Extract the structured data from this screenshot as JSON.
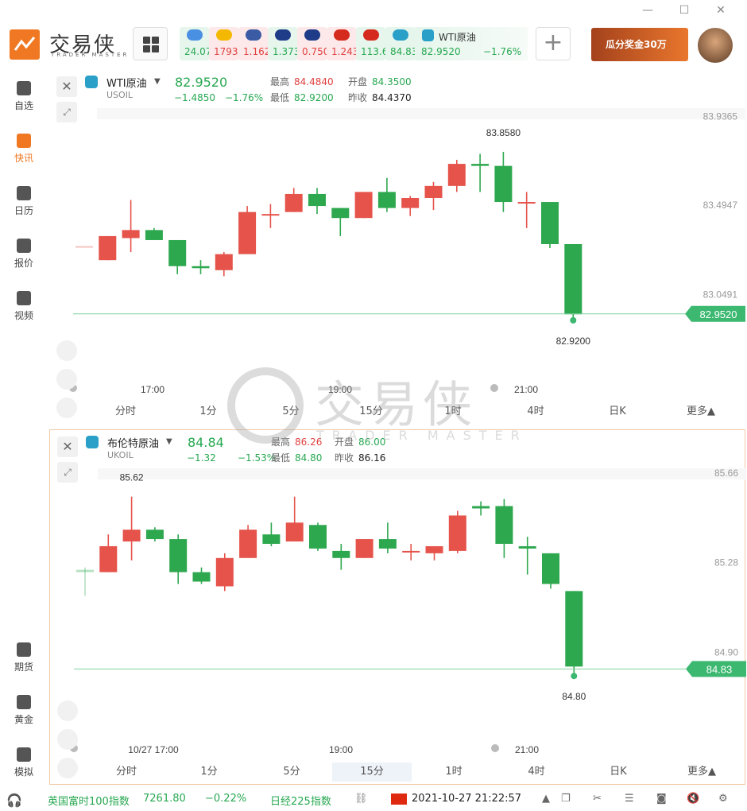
{
  "window": {
    "minimize": "—",
    "maximize": "☐",
    "close": "✕"
  },
  "app": {
    "logo_text": "交易侠",
    "logo_sub": "TRADER MASTER"
  },
  "tickers": [
    {
      "icon": "speech-bubble-icon",
      "value": "24.07",
      "dir": "dn",
      "color": "#4a90e2"
    },
    {
      "icon": "gold-bars-icon",
      "value": "1793",
      "dir": "up",
      "color": "#f5b800"
    },
    {
      "icon": "us-flag-icon",
      "value": "1.162",
      "dir": "up",
      "color": "#3b5ba5"
    },
    {
      "icon": "uk-flag-icon",
      "value": "1.373",
      "dir": "dn",
      "color": "#1f3c88"
    },
    {
      "icon": "au-flag-icon",
      "value": "0.750",
      "dir": "up",
      "color": "#1f3c88"
    },
    {
      "icon": "ca-flag-icon",
      "value": "1.243",
      "dir": "up",
      "color": "#d52b1e"
    },
    {
      "icon": "jp-flag-icon",
      "value": "113.6",
      "dir": "dn",
      "color": "#d52b1e"
    },
    {
      "icon": "ukoil-icon",
      "value": "84.83",
      "dir": "dn",
      "color": "#2aa0c8"
    }
  ],
  "ticker_active": {
    "name": "WTI原油",
    "price": "82.9520",
    "change": "−1.76%"
  },
  "promo": {
    "text": "瓜分奖金30万"
  },
  "sidebar": {
    "items": [
      {
        "label": "自选",
        "icon": "bookmark-icon"
      },
      {
        "label": "快讯",
        "icon": "news-list-icon",
        "active": true
      },
      {
        "label": "日历",
        "icon": "calendar-icon"
      },
      {
        "label": "报价",
        "icon": "trend-chart-icon"
      },
      {
        "label": "视频",
        "icon": "video-play-icon"
      }
    ],
    "bottom_items": [
      {
        "label": "期货",
        "icon": "futures-icon"
      },
      {
        "label": "黄金",
        "icon": "sge-gold-icon"
      },
      {
        "label": "模拟",
        "icon": "wallet-icon"
      }
    ]
  },
  "timeframes": [
    "分时",
    "1分",
    "5分",
    "15分",
    "1时",
    "4时",
    "日K",
    "更多▲"
  ],
  "panels": [
    {
      "name": "WTI原油",
      "symbol": "USOIL",
      "price": "82.9520",
      "change": "−1.4850",
      "change_pct": "−1.76%",
      "high_label": "最高",
      "high": "84.4840",
      "open_label": "开盘",
      "open": "84.3500",
      "low_label": "最低",
      "low": "82.9200",
      "prev_label": "昨收",
      "prev": "84.4370",
      "active_tf": "15分",
      "last_tag": "82.9520",
      "max_label": "83.8580",
      "min_label": "82.9200"
    },
    {
      "name": "布伦特原油",
      "symbol": "UKOIL",
      "price": "84.84",
      "change": "−1.32",
      "change_pct": "−1.53%",
      "high_label": "最高",
      "high": "86.26",
      "open_label": "开盘",
      "open": "86.00",
      "low_label": "最低",
      "low": "84.80",
      "prev_label": "昨收",
      "prev": "86.16",
      "active_tf": "15分",
      "last_tag": "84.83",
      "max_label": "85.62",
      "min_label": "84.80"
    }
  ],
  "chart_data": [
    {
      "type": "candlestick",
      "title": "WTI原油",
      "yticks": [
        "83.9365",
        "83.4947",
        "83.0491"
      ],
      "ytick_values": [
        83.9365,
        83.4947,
        83.0491
      ],
      "xticks": [
        "17:00",
        "19:00",
        "21:00"
      ],
      "last": 82.952,
      "ylim": [
        82.86,
        83.97
      ],
      "candles": [
        {
          "o": 83.29,
          "h": 83.29,
          "l": 83.29,
          "c": 83.29
        },
        {
          "o": 83.22,
          "h": 83.34,
          "l": 83.22,
          "c": 83.34
        },
        {
          "o": 83.33,
          "h": 83.52,
          "l": 83.26,
          "c": 83.37
        },
        {
          "o": 83.37,
          "h": 83.38,
          "l": 83.33,
          "c": 83.32
        },
        {
          "o": 83.32,
          "h": 83.32,
          "l": 83.15,
          "c": 83.19
        },
        {
          "o": 83.19,
          "h": 83.22,
          "l": 83.15,
          "c": 83.18
        },
        {
          "o": 83.17,
          "h": 83.26,
          "l": 83.14,
          "c": 83.25
        },
        {
          "o": 83.25,
          "h": 83.49,
          "l": 83.25,
          "c": 83.46
        },
        {
          "o": 83.45,
          "h": 83.5,
          "l": 83.38,
          "c": 83.45
        },
        {
          "o": 83.46,
          "h": 83.58,
          "l": 83.46,
          "c": 83.55
        },
        {
          "o": 83.55,
          "h": 83.58,
          "l": 83.45,
          "c": 83.49
        },
        {
          "o": 83.48,
          "h": 83.48,
          "l": 83.34,
          "c": 83.43
        },
        {
          "o": 83.43,
          "h": 83.56,
          "l": 83.43,
          "c": 83.56
        },
        {
          "o": 83.56,
          "h": 83.63,
          "l": 83.46,
          "c": 83.48
        },
        {
          "o": 83.48,
          "h": 83.54,
          "l": 83.44,
          "c": 83.53
        },
        {
          "o": 83.53,
          "h": 83.61,
          "l": 83.47,
          "c": 83.59
        },
        {
          "o": 83.59,
          "h": 83.72,
          "l": 83.56,
          "c": 83.7
        },
        {
          "o": 83.7,
          "h": 83.75,
          "l": 83.56,
          "c": 83.69
        },
        {
          "o": 83.69,
          "h": 83.76,
          "l": 83.46,
          "c": 83.51
        },
        {
          "o": 83.51,
          "h": 83.56,
          "l": 83.38,
          "c": 83.51
        },
        {
          "o": 83.51,
          "h": 83.51,
          "l": 83.28,
          "c": 83.3
        },
        {
          "o": 83.3,
          "h": 83.3,
          "l": 82.92,
          "c": 82.95
        }
      ]
    },
    {
      "type": "candlestick",
      "title": "布伦特原油",
      "yticks": [
        "85.66",
        "85.28",
        "84.90"
      ],
      "ytick_values": [
        85.66,
        85.28,
        84.9
      ],
      "xticks": [
        "10/27 17:00",
        "19:00",
        "21:00"
      ],
      "last": 84.83,
      "ylim": [
        84.73,
        85.68
      ],
      "candles": [
        {
          "o": 85.25,
          "h": 85.26,
          "l": 85.14,
          "c": 85.24
        },
        {
          "o": 85.24,
          "h": 85.4,
          "l": 85.24,
          "c": 85.35
        },
        {
          "o": 85.37,
          "h": 85.56,
          "l": 85.29,
          "c": 85.42
        },
        {
          "o": 85.42,
          "h": 85.43,
          "l": 85.37,
          "c": 85.38
        },
        {
          "o": 85.38,
          "h": 85.4,
          "l": 85.19,
          "c": 85.24
        },
        {
          "o": 85.24,
          "h": 85.26,
          "l": 85.19,
          "c": 85.2
        },
        {
          "o": 85.18,
          "h": 85.32,
          "l": 85.16,
          "c": 85.3
        },
        {
          "o": 85.3,
          "h": 85.44,
          "l": 85.3,
          "c": 85.42
        },
        {
          "o": 85.4,
          "h": 85.45,
          "l": 85.35,
          "c": 85.36
        },
        {
          "o": 85.37,
          "h": 85.56,
          "l": 85.37,
          "c": 85.45
        },
        {
          "o": 85.44,
          "h": 85.45,
          "l": 85.33,
          "c": 85.34
        },
        {
          "o": 85.33,
          "h": 85.36,
          "l": 85.25,
          "c": 85.3
        },
        {
          "o": 85.3,
          "h": 85.38,
          "l": 85.3,
          "c": 85.38
        },
        {
          "o": 85.38,
          "h": 85.45,
          "l": 85.32,
          "c": 85.34
        },
        {
          "o": 85.33,
          "h": 85.36,
          "l": 85.29,
          "c": 85.33
        },
        {
          "o": 85.32,
          "h": 85.35,
          "l": 85.29,
          "c": 85.35
        },
        {
          "o": 85.33,
          "h": 85.5,
          "l": 85.32,
          "c": 85.48
        },
        {
          "o": 85.52,
          "h": 85.54,
          "l": 85.48,
          "c": 85.51
        },
        {
          "o": 85.52,
          "h": 85.55,
          "l": 85.3,
          "c": 85.36
        },
        {
          "o": 85.35,
          "h": 85.39,
          "l": 85.23,
          "c": 85.34
        },
        {
          "o": 85.32,
          "h": 85.32,
          "l": 85.17,
          "c": 85.19
        },
        {
          "o": 85.16,
          "h": 85.16,
          "l": 84.8,
          "c": 84.84
        }
      ]
    }
  ],
  "status": {
    "index1_name": "英国富时100指数",
    "index1_value": "7261.80",
    "index1_change": "−0.22%",
    "index2_name": "日经225指数",
    "datetime": "2021-10-27 21:22:57"
  },
  "colors": {
    "up": "#e5534b",
    "down": "#2ea84f",
    "accent": "#f07822"
  }
}
